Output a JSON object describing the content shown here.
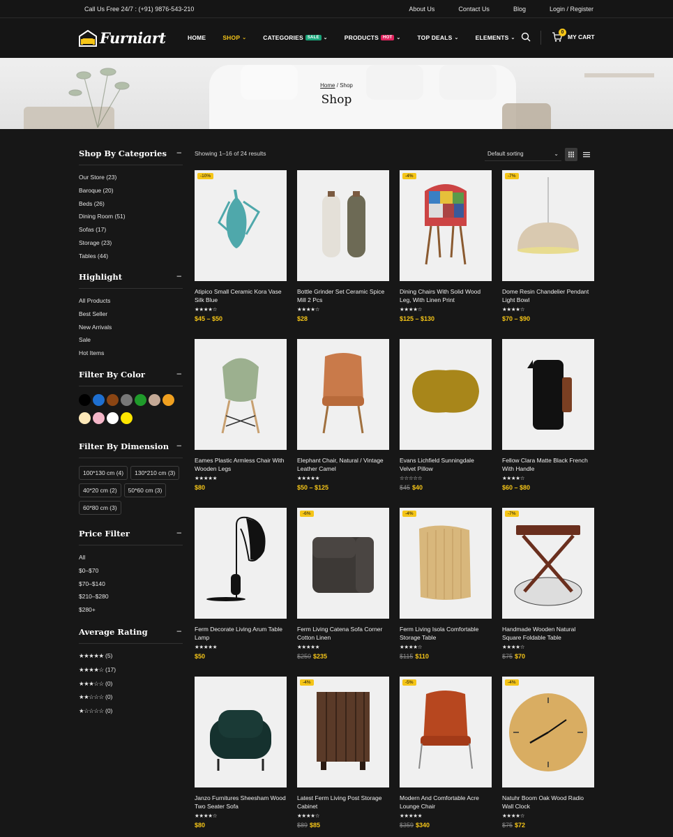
{
  "topbar": {
    "phone": "Call Us Free 24/7 : (+91) 9876-543-210",
    "links": [
      "About Us",
      "Contact Us",
      "Blog",
      "Login / Register"
    ]
  },
  "header": {
    "logo": "Furniart",
    "nav": [
      {
        "label": "HOME",
        "active": false
      },
      {
        "label": "SHOP",
        "active": true,
        "dropdown": true
      },
      {
        "label": "CATEGORIES",
        "badge": "SALE",
        "badge_color": "#1aa57a",
        "dropdown": true
      },
      {
        "label": "PRODUCTS",
        "badge": "HOT",
        "badge_color": "#e0245e",
        "dropdown": true
      },
      {
        "label": "TOP DEALS",
        "dropdown": true
      },
      {
        "label": "ELEMENTS",
        "dropdown": true
      }
    ],
    "cart_label": "MY CART",
    "cart_count": "0",
    "accent": "#f5c518"
  },
  "hero": {
    "breadcrumb_home": "Home",
    "breadcrumb_sep": " / ",
    "breadcrumb_current": "Shop",
    "title": "Shop"
  },
  "sidebar": {
    "categories": {
      "title": "Shop By Categories",
      "items": [
        "Our Store (23)",
        "Baroque (20)",
        "Beds (26)",
        "Dining Room (51)",
        "Sofas (17)",
        "Storage (23)",
        "Tables (44)"
      ]
    },
    "highlight": {
      "title": "Highlight",
      "items": [
        "All Products",
        "Best Seller",
        "New Arrivals",
        "Sale",
        "Hot Items"
      ]
    },
    "color": {
      "title": "Filter By Color",
      "swatches": [
        "#000000",
        "#1e6fd0",
        "#8b4513",
        "#777777",
        "#1f9a2a",
        "#c4a996",
        "#f0a020",
        "#fde8b8",
        "#f4b6c8",
        "#ffffff",
        "#ffe600"
      ]
    },
    "dimension": {
      "title": "Filter By Dimension",
      "items": [
        "100*130 cm (4)",
        "130*210 cm (3)",
        "40*20 cm (2)",
        "50*60 cm (3)",
        "60*80 cm (3)"
      ]
    },
    "price": {
      "title": "Price Filter",
      "items": [
        "All",
        "$0–$70",
        "$70–$140",
        "$210–$280",
        "$280+"
      ]
    },
    "rating": {
      "title": "Average Rating",
      "items": [
        {
          "stars": 5,
          "count": "(5)"
        },
        {
          "stars": 4,
          "count": "(17)"
        },
        {
          "stars": 3,
          "count": "(0)"
        },
        {
          "stars": 2,
          "count": "(0)"
        },
        {
          "stars": 1,
          "count": "(0)"
        }
      ]
    }
  },
  "toolbar": {
    "results": "Showing 1–16 of 24 results",
    "sort": "Default sorting"
  },
  "products": [
    {
      "name": "Atipico Small Ceramic Kora Vase Silk Blue",
      "rating": 4,
      "price": "$45 – $50",
      "old": "",
      "discount": "-10%",
      "icon": "vase"
    },
    {
      "name": "Bottle Grinder Set Ceramic Spice Mill 2 Pcs",
      "rating": 4,
      "price": "$28",
      "old": "",
      "discount": "",
      "icon": "grinder"
    },
    {
      "name": "Dining Chairs With Solid Wood Leg, With Linen Print",
      "rating": 4,
      "price": "$125 – $130",
      "old": "",
      "discount": "-4%",
      "icon": "patch-chair"
    },
    {
      "name": "Dome Resin Chandelier Pendant Light Bowl",
      "rating": 4,
      "price": "$70 – $90",
      "old": "",
      "discount": "-7%",
      "icon": "pendant"
    },
    {
      "name": "Eames Plastic Armless Chair With Wooden Legs",
      "rating": 5,
      "price": "$80",
      "old": "",
      "discount": "",
      "icon": "eames"
    },
    {
      "name": "Elephant Chair, Natural / Vintage Leather Camel",
      "rating": 5,
      "price": "$50 – $125",
      "old": "",
      "discount": "",
      "icon": "leather-chair"
    },
    {
      "name": "Evans Lichfield Sunningdale Velvet Pillow",
      "rating": 0,
      "price": "$40",
      "old": "$45",
      "discount": "",
      "icon": "pillow"
    },
    {
      "name": "Fellow Clara Matte Black French With Handle",
      "rating": 4,
      "price": "$60 – $80",
      "old": "",
      "discount": "",
      "icon": "press"
    },
    {
      "name": "Ferm Decorate Living Arum Table Lamp",
      "rating": 5,
      "price": "$50",
      "old": "",
      "discount": "",
      "icon": "lamp"
    },
    {
      "name": "Ferm Living Catena Sofa Corner Cotton Linen",
      "rating": 5,
      "price": "$235",
      "old": "$250",
      "discount": "-6%",
      "icon": "sofa-corner"
    },
    {
      "name": "Ferm Living Isola Comfortable Storage Table",
      "rating": 4,
      "price": "$110",
      "old": "$115",
      "discount": "-4%",
      "icon": "isola"
    },
    {
      "name": "Handmade Wooden Natural Square Foldable Table",
      "rating": 4,
      "price": "$70",
      "old": "$75",
      "discount": "-7%",
      "icon": "fold-table"
    },
    {
      "name": "Janzo Furnitures Sheesham Wood Two Seater Sofa",
      "rating": 4,
      "price": "$80",
      "old": "",
      "discount": "",
      "icon": "armchair"
    },
    {
      "name": "Latest Ferm Living Post Storage Cabinet",
      "rating": 4,
      "price": "$85",
      "old": "$89",
      "discount": "-4%",
      "icon": "cabinet"
    },
    {
      "name": "Modern And Comfortable Acre Lounge Chair",
      "rating": 5,
      "price": "$340",
      "old": "$359",
      "discount": "-5%",
      "icon": "lounge"
    },
    {
      "name": "Natuhr Boom Oak Wood Radio Wall Clock",
      "rating": 4,
      "price": "$72",
      "old": "$75",
      "discount": "-4%",
      "icon": "clock"
    }
  ]
}
